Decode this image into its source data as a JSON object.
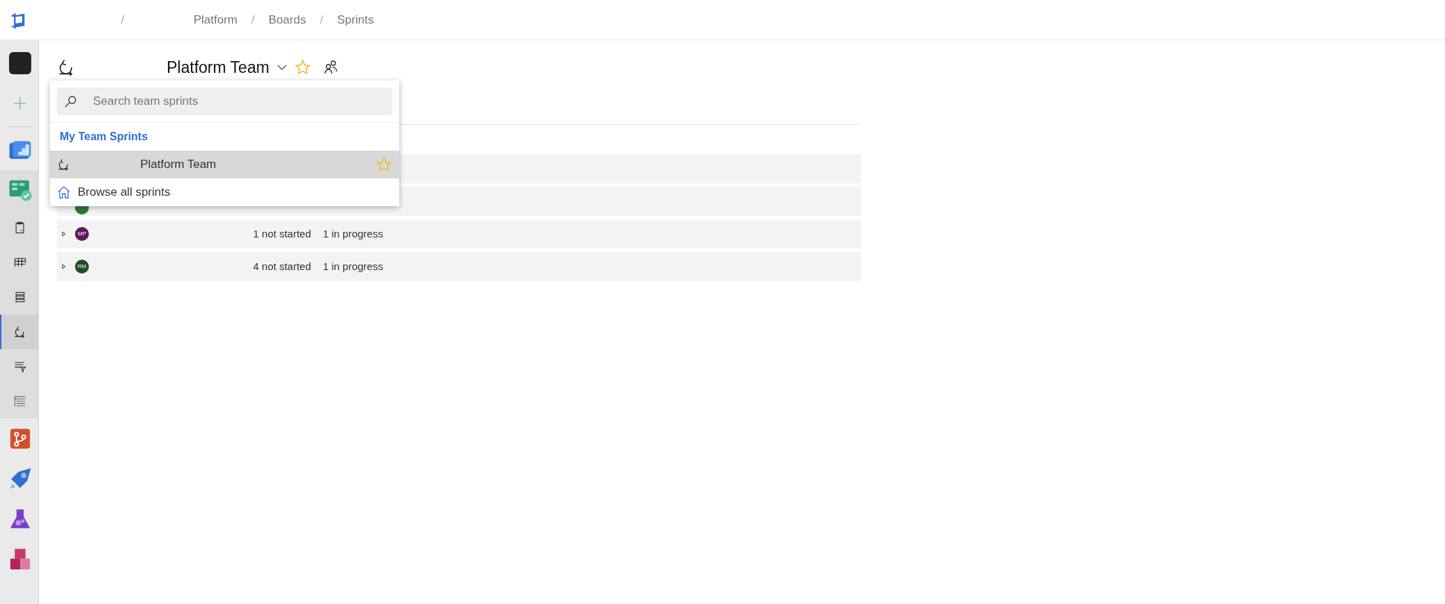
{
  "breadcrumbs": {
    "separator": "/",
    "items": [
      "Platform",
      "Boards",
      "Sprints"
    ]
  },
  "sidebar": [
    {
      "kind": "project",
      "selected": false
    },
    {
      "kind": "add",
      "selected": false
    },
    {
      "kind": "overview",
      "selected": false
    },
    {
      "kind": "boards",
      "selected": false,
      "children": [
        {
          "kind": "work-items",
          "selected": false
        },
        {
          "kind": "board",
          "selected": false
        },
        {
          "kind": "backlog",
          "selected": false
        },
        {
          "kind": "sprints",
          "selected": true
        },
        {
          "kind": "queries",
          "selected": false
        },
        {
          "kind": "plans",
          "selected": false
        }
      ]
    },
    {
      "kind": "repos",
      "selected": false
    },
    {
      "kind": "pipelines",
      "selected": false
    },
    {
      "kind": "test",
      "selected": false
    },
    {
      "kind": "artifacts",
      "selected": false
    }
  ],
  "header": {
    "title": "Platform Team",
    "favorite": true
  },
  "dropdown": {
    "search": {
      "placeholder": "Search team sprints"
    },
    "section": "My Team Sprints",
    "items": [
      {
        "label": "Platform Team",
        "selected": true,
        "favorite": true
      }
    ],
    "link": "Browse all sprints"
  },
  "rows": [
    {
      "kind": "covered"
    },
    {
      "kind": "covered",
      "color": "#2f7a32"
    },
    {
      "kind": "member",
      "initials": "MP",
      "color": "#5c1a5c",
      "not_started": "1 not started",
      "in_progress": "1 in progress"
    },
    {
      "kind": "member",
      "initials": "RM",
      "color": "#1f4d24",
      "not_started": "4 not started",
      "in_progress": "1 in progress"
    }
  ]
}
